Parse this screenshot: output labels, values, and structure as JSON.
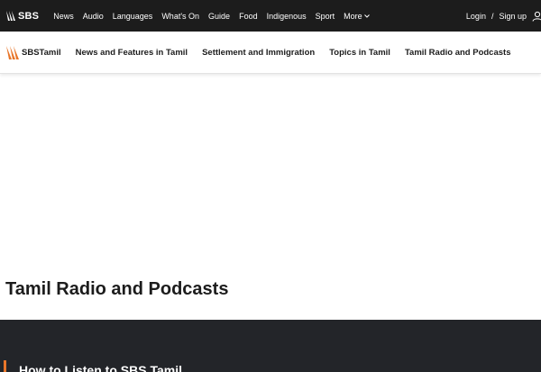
{
  "topbar": {
    "brand": "SBS",
    "nav": [
      "News",
      "Audio",
      "Languages",
      "What's On",
      "Guide",
      "Food",
      "Indigenous",
      "Sport"
    ],
    "more_label": "More",
    "login_label": "Login",
    "divider": "/",
    "signup_label": "Sign up"
  },
  "subnav": {
    "brand_prefix": "SBS",
    "brand_suffix": "Tamil",
    "items": [
      "News and Features in Tamil",
      "Settlement and Immigration",
      "Topics in Tamil",
      "Tamil Radio and Podcasts"
    ]
  },
  "main": {
    "title": "Tamil Radio and Podcasts"
  },
  "section": {
    "heading": "How to Listen to SBS Tamil"
  },
  "colors": {
    "brand_orange": "#e8762a",
    "topbar_bg": "#1c1c1c",
    "section_bg": "#232529"
  }
}
